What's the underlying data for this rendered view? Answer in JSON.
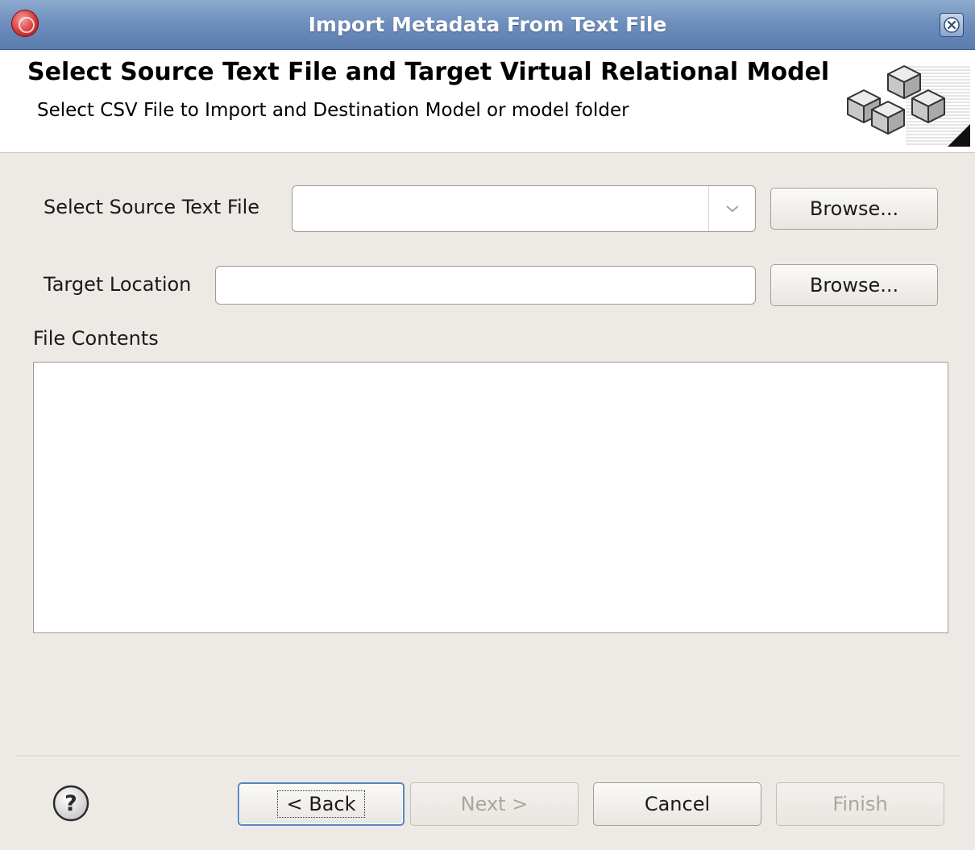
{
  "window": {
    "title": "Import Metadata From Text File"
  },
  "banner": {
    "heading": "Select Source Text File and Target Virtual Relational Model",
    "subheading": "Select CSV File to Import and Destination Model or model folder",
    "graphic_icon": "stacked-cubes-icon"
  },
  "form": {
    "source_label": "Select Source Text File",
    "source_value": "",
    "source_browse_label": "Browse...",
    "target_label": "Target Location",
    "target_value": "",
    "target_browse_label": "Browse...",
    "contents_label": "File Contents",
    "contents_value": ""
  },
  "footer": {
    "help_icon": "help-icon",
    "back_label": "< Back",
    "next_label": "Next >",
    "cancel_label": "Cancel",
    "finish_label": "Finish"
  },
  "colors": {
    "titlebar": "#6f8fbd",
    "dialog_bg": "#edeae5",
    "focus_border": "#5b86bd"
  }
}
